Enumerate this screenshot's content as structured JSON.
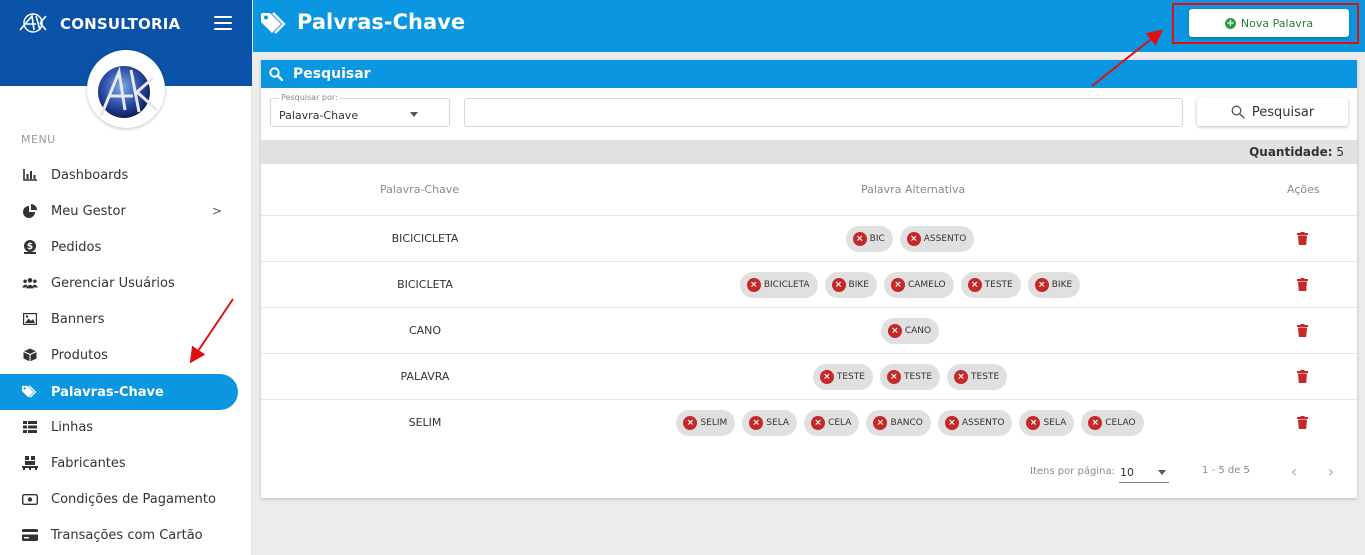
{
  "brand": {
    "name": "CONSULTORIA"
  },
  "menu": {
    "caption": "MENU",
    "items": [
      {
        "label": "Dashboards",
        "icon": "bar-chart-icon"
      },
      {
        "label": "Meu Gestor",
        "icon": "pie-chart-icon",
        "chevron": ">"
      },
      {
        "label": "Pedidos",
        "icon": "dollar-icon"
      },
      {
        "label": "Gerenciar Usuários",
        "icon": "users-icon"
      },
      {
        "label": "Banners",
        "icon": "image-icon"
      },
      {
        "label": "Produtos",
        "icon": "box-icon"
      },
      {
        "label": "Palavras-Chave",
        "icon": "tags-icon",
        "active": true
      },
      {
        "label": "Linhas",
        "icon": "list-icon"
      },
      {
        "label": "Fabricantes",
        "icon": "pallet-icon"
      },
      {
        "label": "Condições de Pagamento",
        "icon": "money-icon"
      },
      {
        "label": "Transações com Cartão",
        "icon": "credit-card-icon"
      }
    ]
  },
  "header": {
    "title": "Palvras-Chave",
    "new_button": "Nova Palavra"
  },
  "search": {
    "title": "Pesquisar",
    "select_label": "Pesquisar por:",
    "select_value": "Palavra-Chave",
    "input_value": "",
    "button": "Pesquisar"
  },
  "quantity": {
    "label": "Quantidade:",
    "value": "5"
  },
  "table": {
    "headers": [
      "Palavra-Chave",
      "Palavra Alternativa",
      "Ações"
    ],
    "rows": [
      {
        "keyword": "BICICICLETA",
        "alternatives": [
          "BIC",
          "ASSENTO"
        ]
      },
      {
        "keyword": "BICICLETA",
        "alternatives": [
          "BICICLETA",
          "BIKE",
          "CAMELO",
          "TESTE",
          "BIKE"
        ]
      },
      {
        "keyword": "CANO",
        "alternatives": [
          "CANO"
        ]
      },
      {
        "keyword": "PALAVRA",
        "alternatives": [
          "TESTE",
          "TESTE",
          "TESTE"
        ]
      },
      {
        "keyword": "SELIM",
        "alternatives": [
          "SELIM",
          "SELA",
          "CELA",
          "BANCO",
          "ASSENTO",
          "SELA",
          "CELAO"
        ]
      }
    ]
  },
  "pagination": {
    "items_label": "Itens por página:",
    "items_value": "10",
    "range": "1 - 5 de 5"
  },
  "colors": {
    "brand_dark": "#0a51a8",
    "primary": "#0a96e0",
    "danger": "#c62828",
    "success": "#2e9e3e",
    "annotation": "#e01010"
  }
}
